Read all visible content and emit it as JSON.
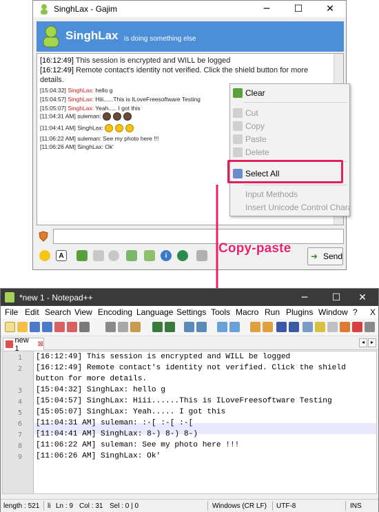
{
  "gajim": {
    "window_title": "SinghLax - Gajim",
    "contact_name": "SinghLax",
    "contact_status": "is doing something else",
    "log": [
      {
        "time": "[16:12:49]",
        "text": "This session is encrypted and WILL be logged",
        "style": "system"
      },
      {
        "time": "[16:12:49]",
        "text": "Remote contact's identity not verified. Click the shield button for more",
        "style": "system"
      },
      {
        "time": "",
        "text": "details.",
        "style": "system-cont"
      },
      {
        "time": "[15:04:32]",
        "nick": "SinghLax:",
        "text": "hello g",
        "style": "red"
      },
      {
        "time": "[15:04:57]",
        "nick": "SinghLax:",
        "text": "Hiii......This is ILoveFreesoftware Testing",
        "style": "red"
      },
      {
        "time": "[15:05:07]",
        "nick": "SinghLax:",
        "text": "Yeah..... I got this",
        "style": "red"
      },
      {
        "time": "[11:04:31 AM]",
        "nick": "suleman:",
        "text": "",
        "style": "plain",
        "emojis": 3,
        "emoji_kind": "dark"
      },
      {
        "time": "[11:04:41 AM]",
        "nick": "SinghLax:",
        "text": "",
        "style": "plain",
        "emojis": 3,
        "emoji_kind": "cool"
      },
      {
        "time": "[11:06:22 AM]",
        "nick": "suleman:",
        "text": "See my photo here !!!",
        "style": "plain"
      },
      {
        "time": "[11:06:26 AM]",
        "nick": "SinghLax:",
        "text": "Ok'",
        "style": "plain"
      }
    ],
    "send_label": "Send",
    "context_menu": {
      "clear": "Clear",
      "cut": "Cut",
      "copy": "Copy",
      "paste": "Paste",
      "delete": "Delete",
      "select_all": "Select All",
      "input_methods": "Input Methods",
      "insert_unicode": "Insert Unicode Control Chara"
    }
  },
  "annotation": {
    "caption": "Copy-paste",
    "color": "#e8206a"
  },
  "notepad": {
    "window_title": "*new 1 - Notepad++",
    "menu": [
      "File",
      "Edit",
      "Search",
      "View",
      "Encoding",
      "Language",
      "Settings",
      "Tools",
      "Macro",
      "Run",
      "Plugins",
      "Window",
      "?"
    ],
    "menu_close": "X",
    "tab_label": "new 1",
    "lines": [
      {
        "n": "1",
        "text": "[16:12:49] This session is encrypted and WILL be logged"
      },
      {
        "n": "2",
        "text": "[16:12:49] Remote contact's identity not verified. Click the shield"
      },
      {
        "n": "",
        "text": "button for more details."
      },
      {
        "n": "3",
        "text": "[15:04:32] SinghLax: hello g"
      },
      {
        "n": "4",
        "text": "[15:04:57] SinghLax:  Hiii......This is ILoveFreesoftware Testing"
      },
      {
        "n": "5",
        "text": "[15:05:07] SinghLax:  Yeah..... I got this"
      },
      {
        "n": "6",
        "text": "[11:04:31 AM] suleman: :-[  :-[  :-["
      },
      {
        "n": "7",
        "text": "[11:04:41 AM] SinghLax: 8-)  8-)  8-)"
      },
      {
        "n": "8",
        "text": "[11:06:22 AM] suleman: See my photo here !!!"
      },
      {
        "n": "9",
        "text": "[11:06:26 AM] SinghLax: Ok'"
      }
    ],
    "status": {
      "length": "length : 521",
      "lines_abbrev": "li",
      "ln": "Ln : 9",
      "col": "Col : 31",
      "sel": "Sel : 0 | 0",
      "eol": "Windows (CR LF)",
      "encoding": "UTF-8",
      "mode": "INS"
    }
  },
  "colors": {
    "gajim_banner": "#4c8ed8",
    "system_green": "#2aa02a",
    "nick_red": "#c8201e",
    "highlight": "#e0205e"
  }
}
